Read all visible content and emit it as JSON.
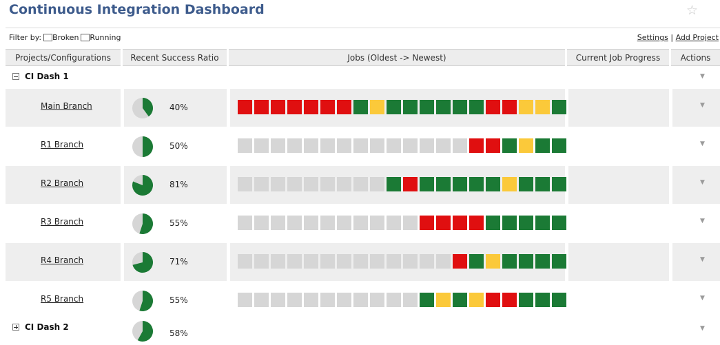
{
  "title": "Continuous Integration Dashboard",
  "star_icon": "star-icon",
  "filter": {
    "label": "Filter by:",
    "options": [
      "Broken",
      "Running"
    ]
  },
  "links": {
    "settings": "Settings",
    "separator": "|",
    "add_project": "Add Project"
  },
  "columns": [
    "Projects/Configurations",
    "Recent Success Ratio",
    "Jobs (Oldest -> Newest)",
    "Current Job Progress",
    "Actions"
  ],
  "colors": {
    "success": "#1b7a35",
    "failure": "#e00f10",
    "unstable": "#fbc93a",
    "empty": "#d6d6d6",
    "title": "#3d5b8c"
  },
  "groups": [
    {
      "name": "CI Dash 1",
      "expanded": true,
      "branches": [
        {
          "name": "Main Branch",
          "ratio": 40,
          "ratio_label": "40%",
          "jobs": [
            "F",
            "F",
            "F",
            "F",
            "F",
            "F",
            "F",
            "S",
            "U",
            "S",
            "S",
            "S",
            "S",
            "S",
            "S",
            "F",
            "F",
            "U",
            "U",
            "S"
          ]
        },
        {
          "name": "R1 Branch",
          "ratio": 50,
          "ratio_label": "50%",
          "jobs": [
            "E",
            "E",
            "E",
            "E",
            "E",
            "E",
            "E",
            "E",
            "E",
            "E",
            "E",
            "E",
            "E",
            "E",
            "F",
            "F",
            "S",
            "U",
            "S",
            "S"
          ]
        },
        {
          "name": "R2 Branch",
          "ratio": 81,
          "ratio_label": "81%",
          "jobs": [
            "E",
            "E",
            "E",
            "E",
            "E",
            "E",
            "E",
            "E",
            "E",
            "S",
            "F",
            "S",
            "S",
            "S",
            "S",
            "S",
            "U",
            "S",
            "S",
            "S"
          ]
        },
        {
          "name": "R3 Branch",
          "ratio": 55,
          "ratio_label": "55%",
          "jobs": [
            "E",
            "E",
            "E",
            "E",
            "E",
            "E",
            "E",
            "E",
            "E",
            "E",
            "E",
            "F",
            "F",
            "F",
            "F",
            "S",
            "S",
            "S",
            "S",
            "S"
          ]
        },
        {
          "name": "R4 Branch",
          "ratio": 71,
          "ratio_label": "71%",
          "jobs": [
            "E",
            "E",
            "E",
            "E",
            "E",
            "E",
            "E",
            "E",
            "E",
            "E",
            "E",
            "E",
            "E",
            "F",
            "S",
            "U",
            "S",
            "S",
            "S",
            "S"
          ]
        },
        {
          "name": "R5 Branch",
          "ratio": 55,
          "ratio_label": "55%",
          "jobs": [
            "E",
            "E",
            "E",
            "E",
            "E",
            "E",
            "E",
            "E",
            "E",
            "E",
            "E",
            "S",
            "U",
            "S",
            "U",
            "F",
            "F",
            "S",
            "S",
            "S"
          ]
        }
      ]
    },
    {
      "name": "CI Dash 2",
      "expanded": false,
      "ratio": 58,
      "ratio_label": "58%"
    }
  ]
}
